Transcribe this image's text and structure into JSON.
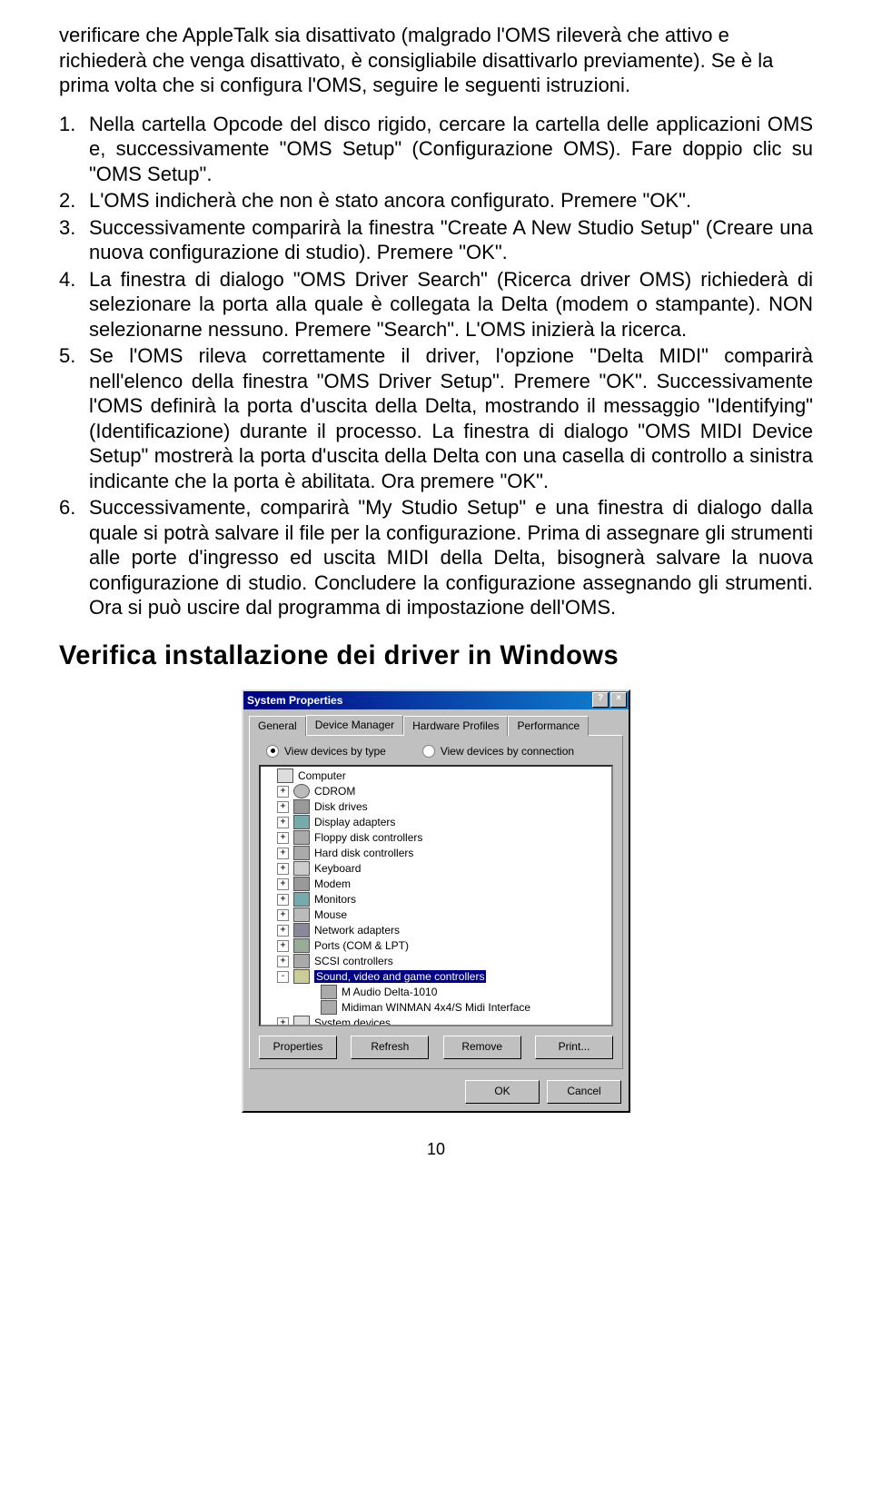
{
  "intro": "verificare che AppleTalk sia disattivato (malgrado l'OMS rileverà che attivo e richiederà che venga disattivato, è consigliabile disattivarlo previamente). Se è la prima volta che si configura l'OMS, seguire le seguenti istruzioni.",
  "items": [
    {
      "num": "1.",
      "text": "Nella cartella Opcode del disco rigido, cercare la cartella delle applicazioni OMS e, successivamente \"OMS Setup\" (Configurazione OMS). Fare doppio clic su \"OMS Setup\"."
    },
    {
      "num": "2.",
      "text": "L'OMS indicherà che non è stato ancora configurato. Premere \"OK\"."
    },
    {
      "num": "3.",
      "text": "Successivamente comparirà la finestra \"Create A New Studio Setup\" (Creare una nuova configurazione di studio). Premere \"OK\"."
    },
    {
      "num": "4.",
      "text": "La finestra di dialogo \"OMS Driver Search\" (Ricerca driver OMS) richiederà di selezionare la porta alla quale è collegata la Delta (modem o stampante). NON selezionarne nessuno. Premere \"Search\". L'OMS inizierà la ricerca."
    },
    {
      "num": "5.",
      "text": "Se l'OMS rileva correttamente il driver, l'opzione \"Delta MIDI\" comparirà nell'elenco della finestra \"OMS Driver Setup\". Premere \"OK\". Successivamente l'OMS definirà la porta d'uscita della Delta, mostrando il messaggio \"Identifying\" (Identificazione) durante il processo.  La finestra di dialogo \"OMS MIDI Device Setup\" mostrerà la porta d'uscita della Delta con una casella di controllo a sinistra indicante che la porta è abilitata. Ora premere \"OK\"."
    },
    {
      "num": "6.",
      "text": "Successivamente, comparirà \"My Studio Setup\" e una finestra di dialogo dalla quale si potrà salvare il file per la configurazione. Prima di assegnare gli strumenti alle porte d'ingresso ed uscita MIDI della Delta, bisognerà salvare la nuova configurazione di studio. Concludere la configurazione assegnando gli strumenti. Ora si può uscire dal programma di impostazione dell'OMS."
    }
  ],
  "heading": "Verifica installazione dei driver in Windows",
  "dialog": {
    "title": "System Properties",
    "help_btn": "?",
    "close_btn": "×",
    "tabs": [
      "General",
      "Device Manager",
      "Hardware Profiles",
      "Performance"
    ],
    "active_tab": 1,
    "radio1": "View devices by type",
    "radio2": "View devices by connection",
    "tree": [
      {
        "indent": 0,
        "icon": "pc",
        "label": "Computer",
        "box": ""
      },
      {
        "indent": 1,
        "icon": "cd",
        "label": "CDROM",
        "box": "+"
      },
      {
        "indent": 1,
        "icon": "disk",
        "label": "Disk drives",
        "box": "+"
      },
      {
        "indent": 1,
        "icon": "disp",
        "label": "Display adapters",
        "box": "+"
      },
      {
        "indent": 1,
        "icon": "ctrl",
        "label": "Floppy disk controllers",
        "box": "+"
      },
      {
        "indent": 1,
        "icon": "ctrl",
        "label": "Hard disk controllers",
        "box": "+"
      },
      {
        "indent": 1,
        "icon": "kb",
        "label": "Keyboard",
        "box": "+"
      },
      {
        "indent": 1,
        "icon": "modem",
        "label": "Modem",
        "box": "+"
      },
      {
        "indent": 1,
        "icon": "mon",
        "label": "Monitors",
        "box": "+"
      },
      {
        "indent": 1,
        "icon": "mouse",
        "label": "Mouse",
        "box": "+"
      },
      {
        "indent": 1,
        "icon": "net",
        "label": "Network adapters",
        "box": "+"
      },
      {
        "indent": 1,
        "icon": "port",
        "label": "Ports (COM & LPT)",
        "box": "+"
      },
      {
        "indent": 1,
        "icon": "ctrl",
        "label": "SCSI controllers",
        "box": "+"
      },
      {
        "indent": 1,
        "icon": "sound",
        "label": "Sound, video and game controllers",
        "box": "-",
        "sel": true
      },
      {
        "indent": 2,
        "icon": "dev",
        "label": "M Audio Delta-1010",
        "box": ""
      },
      {
        "indent": 2,
        "icon": "dev",
        "label": "Midiman WINMAN 4x4/S Midi Interface",
        "box": ""
      },
      {
        "indent": 1,
        "icon": "pc",
        "label": "System devices",
        "box": "+"
      }
    ],
    "buttons": [
      "Properties",
      "Refresh",
      "Remove",
      "Print..."
    ],
    "ok": "OK",
    "cancel": "Cancel"
  },
  "page_number": "10"
}
